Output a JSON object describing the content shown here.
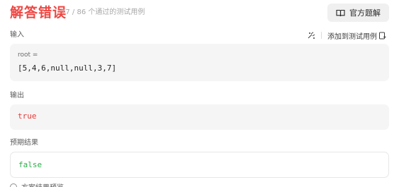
{
  "header": {
    "status": "解答错误",
    "test_count": "77 / 86 个通过的测试用例",
    "solution_button": "官方题解"
  },
  "input": {
    "label": "输入",
    "add_testcase": "添加到测试用例",
    "param_name": "root =",
    "value": "[5,4,6,null,null,3,7]"
  },
  "output": {
    "label": "输出",
    "value": "true"
  },
  "expected": {
    "label": "预期结果",
    "value": "false"
  },
  "footer": {
    "text": "方案结果预览"
  },
  "colors": {
    "error": "#ef4743",
    "output_text": "#e53935",
    "expected_text": "#2eab4b"
  }
}
